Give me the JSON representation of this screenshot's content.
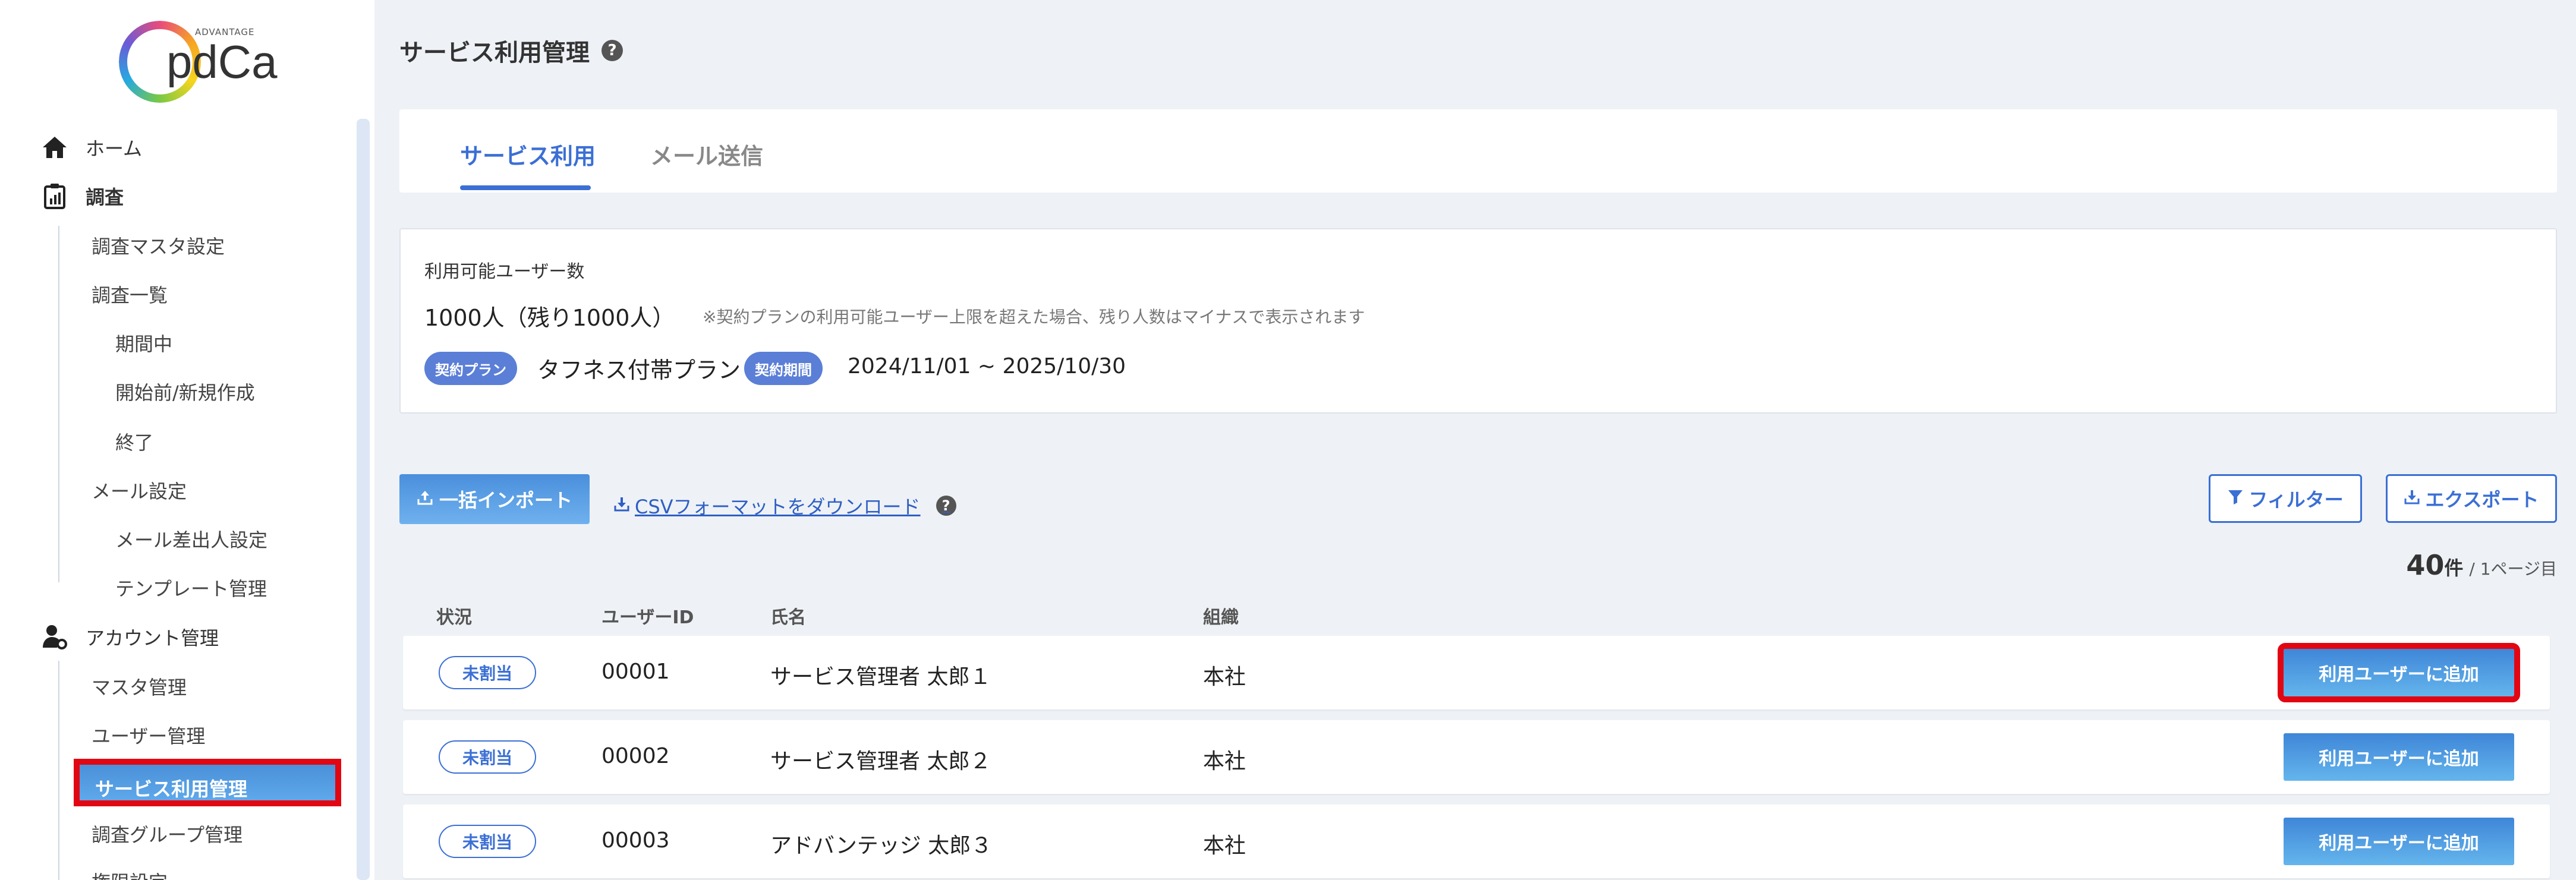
{
  "brand": {
    "small": "ADVANTAGE",
    "name": "pdCa"
  },
  "sidebar": {
    "home": "ホーム",
    "survey": "調査",
    "survey_master": "調査マスタ設定",
    "survey_list": "調査一覧",
    "in_period": "期間中",
    "before_start": "開始前/新規作成",
    "ended": "終了",
    "mail_settings": "メール設定",
    "mail_sender": "メール差出人設定",
    "template_mgmt": "テンプレート管理",
    "account_mgmt": "アカウント管理",
    "master_mgmt": "マスタ管理",
    "user_mgmt": "ユーザー管理",
    "service_mgmt": "サービス利用管理",
    "survey_group_mgmt": "調査グループ管理",
    "cut_item": "権限設定"
  },
  "page": {
    "title": "サービス利用管理",
    "help": "?"
  },
  "tabs": [
    {
      "label": "サービス利用"
    },
    {
      "label": "メール送信"
    }
  ],
  "info": {
    "label": "利用可能ユーザー数",
    "count": "1000人（残り1000人）",
    "note": "※契約プランの利用可能ユーザー上限を超えた場合、残り人数はマイナスで表示されます",
    "plan_badge": "契約プラン",
    "plan": "タフネス付帯プラン",
    "period_badge": "契約期間",
    "period": "2024/11/01 ~ 2025/10/30"
  },
  "toolbar": {
    "import": "一括インポート",
    "csv": "CSVフォーマットをダウンロード",
    "filter": "フィルター",
    "export": "エクスポート"
  },
  "pagination": {
    "count": "40",
    "unit": "件",
    "page": "/ 1ページ目"
  },
  "table": {
    "headers": {
      "status": "状況",
      "user_id": "ユーザーID",
      "name": "氏名",
      "org": "組織"
    },
    "rows": [
      {
        "status": "未割当",
        "user_id": "00001",
        "name": "サービス管理者 太郎１",
        "org": "本社",
        "action": "利用ユーザーに追加"
      },
      {
        "status": "未割当",
        "user_id": "00002",
        "name": "サービス管理者 太郎２",
        "org": "本社",
        "action": "利用ユーザーに追加"
      },
      {
        "status": "未割当",
        "user_id": "00003",
        "name": "アドバンテッジ 太郎３",
        "org": "本社",
        "action": "利用ユーザーに追加"
      }
    ]
  },
  "colors": {
    "accent": "#3b6fd4",
    "highlight": "#e20613",
    "background": "#eef2f6"
  }
}
